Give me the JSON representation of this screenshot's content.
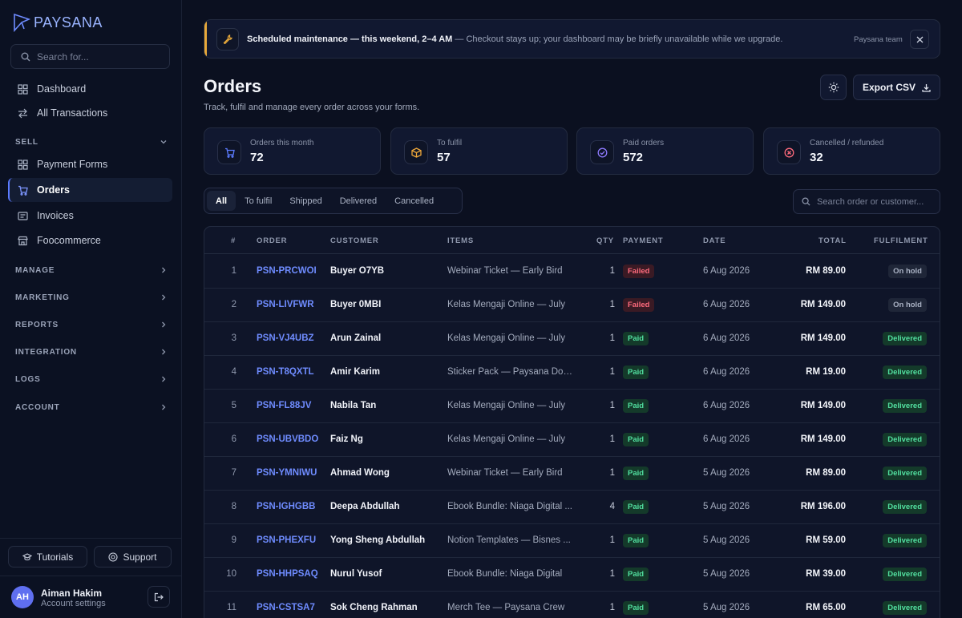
{
  "brand": {
    "name": "PAYSANA"
  },
  "sidebar": {
    "search_placeholder": "Search for...",
    "top_items": [
      {
        "label": "Dashboard"
      },
      {
        "label": "All Transactions"
      }
    ],
    "sell_section": "SELL",
    "sell_items": [
      {
        "label": "Payment Forms"
      },
      {
        "label": "Orders"
      },
      {
        "label": "Invoices"
      },
      {
        "label": "Foocommerce"
      }
    ],
    "sections": [
      "MANAGE",
      "MARKETING",
      "REPORTS",
      "INTEGRATION",
      "LOGS",
      "ACCOUNT"
    ],
    "tutorials": "Tutorials",
    "support": "Support",
    "user": {
      "initials": "AH",
      "name": "Aiman Hakim",
      "sub": "Account settings"
    }
  },
  "banner": {
    "title": "Scheduled maintenance — this weekend, 2–4 AM",
    "message": " — Checkout stays up; your dashboard may be briefly unavailable while we upgrade.",
    "team": "Paysana team"
  },
  "header": {
    "title": "Orders",
    "subtitle": "Track, fulfil and manage every order across your forms.",
    "export_label": "Export CSV"
  },
  "stats": [
    {
      "label": "Orders this month",
      "value": "72",
      "color": "#5b7bff"
    },
    {
      "label": "To fulfil",
      "value": "57",
      "color": "#f0a93a"
    },
    {
      "label": "Paid orders",
      "value": "572",
      "color": "#8f7bff"
    },
    {
      "label": "Cancelled / refunded",
      "value": "32",
      "color": "#ff6b7d"
    }
  ],
  "tabs": [
    "All",
    "To fulfil",
    "Shipped",
    "Delivered",
    "Cancelled"
  ],
  "order_search_placeholder": "Search order or customer...",
  "table": {
    "headers": [
      "#",
      "ORDER",
      "CUSTOMER",
      "ITEMS",
      "QTY",
      "PAYMENT",
      "DATE",
      "TOTAL",
      "FULFILMENT"
    ],
    "rows": [
      {
        "num": "1",
        "order": "PSN-PRCWOI",
        "customer": "Buyer O7YB",
        "items": "Webinar Ticket — Early Bird",
        "qty": "1",
        "payment": "Failed",
        "date": "6 Aug 2026",
        "total": "RM 89.00",
        "fulfilment": "On hold"
      },
      {
        "num": "2",
        "order": "PSN-LIVFWR",
        "customer": "Buyer 0MBI",
        "items": "Kelas Mengaji Online — July",
        "qty": "1",
        "payment": "Failed",
        "date": "6 Aug 2026",
        "total": "RM 149.00",
        "fulfilment": "On hold"
      },
      {
        "num": "3",
        "order": "PSN-VJ4UBZ",
        "customer": "Arun Zainal",
        "items": "Kelas Mengaji Online — July",
        "qty": "1",
        "payment": "Paid",
        "date": "6 Aug 2026",
        "total": "RM 149.00",
        "fulfilment": "Delivered"
      },
      {
        "num": "4",
        "order": "PSN-T8QXTL",
        "customer": "Amir Karim",
        "items": "Sticker Pack — Paysana Doo...",
        "qty": "1",
        "payment": "Paid",
        "date": "6 Aug 2026",
        "total": "RM 19.00",
        "fulfilment": "Delivered"
      },
      {
        "num": "5",
        "order": "PSN-FL88JV",
        "customer": "Nabila Tan",
        "items": "Kelas Mengaji Online — July",
        "qty": "1",
        "payment": "Paid",
        "date": "6 Aug 2026",
        "total": "RM 149.00",
        "fulfilment": "Delivered"
      },
      {
        "num": "6",
        "order": "PSN-UBVBDO",
        "customer": "Faiz Ng",
        "items": "Kelas Mengaji Online — July",
        "qty": "1",
        "payment": "Paid",
        "date": "6 Aug 2026",
        "total": "RM 149.00",
        "fulfilment": "Delivered"
      },
      {
        "num": "7",
        "order": "PSN-YMNIWU",
        "customer": "Ahmad Wong",
        "items": "Webinar Ticket — Early Bird",
        "qty": "1",
        "payment": "Paid",
        "date": "5 Aug 2026",
        "total": "RM 89.00",
        "fulfilment": "Delivered"
      },
      {
        "num": "8",
        "order": "PSN-IGHGBB",
        "customer": "Deepa Abdullah",
        "items": "Ebook Bundle: Niaga Digital ...",
        "qty": "4",
        "payment": "Paid",
        "date": "5 Aug 2026",
        "total": "RM 196.00",
        "fulfilment": "Delivered"
      },
      {
        "num": "9",
        "order": "PSN-PHEXFU",
        "customer": "Yong Sheng Abdullah",
        "items": "Notion Templates — Bisnes ...",
        "qty": "1",
        "payment": "Paid",
        "date": "5 Aug 2026",
        "total": "RM 59.00",
        "fulfilment": "Delivered"
      },
      {
        "num": "10",
        "order": "PSN-HHPSAQ",
        "customer": "Nurul Yusof",
        "items": "Ebook Bundle: Niaga Digital",
        "qty": "1",
        "payment": "Paid",
        "date": "5 Aug 2026",
        "total": "RM 39.00",
        "fulfilment": "Delivered"
      },
      {
        "num": "11",
        "order": "PSN-CSTSA7",
        "customer": "Sok Cheng Rahman",
        "items": "Merch Tee — Paysana Crew",
        "qty": "1",
        "payment": "Paid",
        "date": "5 Aug 2026",
        "total": "RM 65.00",
        "fulfilment": "Delivered"
      }
    ]
  }
}
